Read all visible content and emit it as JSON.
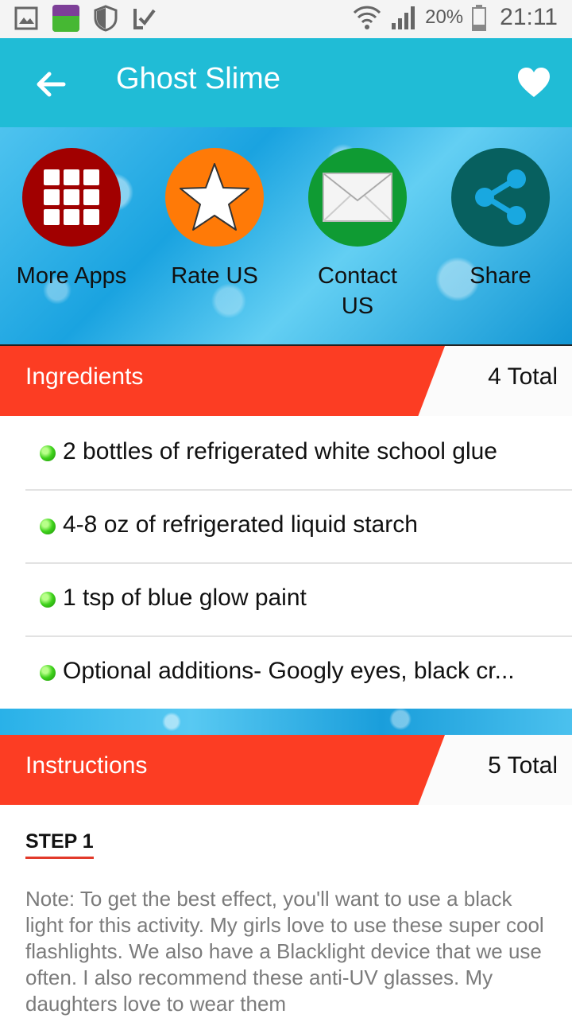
{
  "status_bar": {
    "battery_percent": "20%",
    "time": "21:11"
  },
  "toolbar": {
    "title": "Ghost Slime"
  },
  "actions": [
    {
      "label": "More Apps",
      "icon": "grid-icon",
      "color": "#a10000"
    },
    {
      "label": "Rate US",
      "icon": "star-icon",
      "color": "#ff7a07"
    },
    {
      "label": "Contact US",
      "icon": "mail-icon",
      "color": "#0f9b33"
    },
    {
      "label": "Share",
      "icon": "share-icon",
      "color": "#07605f"
    }
  ],
  "ingredients": {
    "title": "Ingredients",
    "total": "4 Total",
    "items": [
      "2 bottles of refrigerated white school glue",
      "4-8 oz of refrigerated liquid starch",
      "1 tsp of blue glow paint",
      "Optional additions- Googly eyes, black cr..."
    ]
  },
  "instructions": {
    "title": "Instructions",
    "total": "5 Total",
    "step_label": "STEP 1",
    "step_text": "Note: To get the best effect, you'll want to use a black light for this activity. My girls love to use these super cool flashlights. We also have a Blacklight device that we use often. I also recommend these anti-UV glasses. My daughters love to wear them"
  },
  "colors": {
    "toolbar": "#20bcd6",
    "section_band": "#fc3d23",
    "bullet": "#3fd21c"
  }
}
